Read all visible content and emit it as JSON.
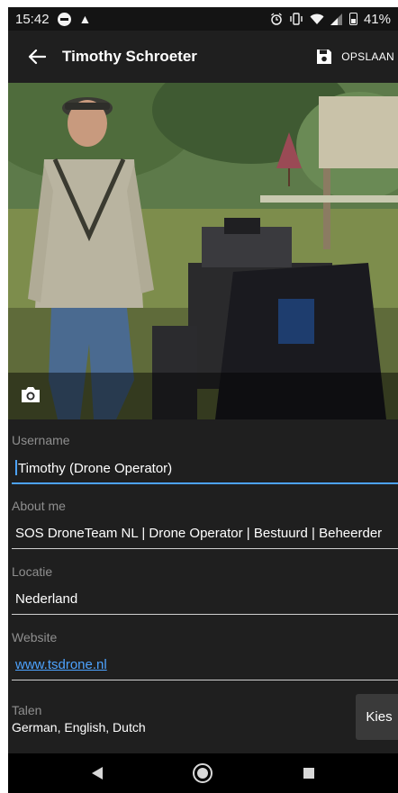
{
  "status_bar": {
    "time": "15:42",
    "battery": "41%",
    "icons": [
      "do-not-disturb-icon",
      "alert-icon",
      "alarm-icon",
      "vibrate-icon",
      "wifi-icon",
      "signal-icon",
      "battery-icon"
    ]
  },
  "app_bar": {
    "title": "Timothy Schroeter",
    "save_label": "OPSLAAN",
    "icons": [
      "back-arrow-icon",
      "save-icon"
    ]
  },
  "photo": {
    "subject": "profile photo",
    "camera_icon": "camera-icon"
  },
  "form": {
    "username": {
      "label": "Username",
      "value": "Timothy (Drone Operator)"
    },
    "about": {
      "label": "About me",
      "value": "SOS DroneTeam NL | Drone Operator | Bestuurd | Beheerder"
    },
    "location": {
      "label": "Locatie",
      "value": "Nederland"
    },
    "website": {
      "label": "Website",
      "value": "www.tsdrone.nl"
    },
    "languages": {
      "label": "Talen",
      "value": "German, English, Dutch",
      "button": "Kies"
    }
  },
  "nav_bar": {
    "icons": [
      "back-icon",
      "home-icon",
      "recents-icon"
    ]
  },
  "colors": {
    "background": "#1f1f1f",
    "accent": "#4da3ff",
    "label": "#8f8f8f",
    "button": "#3a3a3a"
  }
}
